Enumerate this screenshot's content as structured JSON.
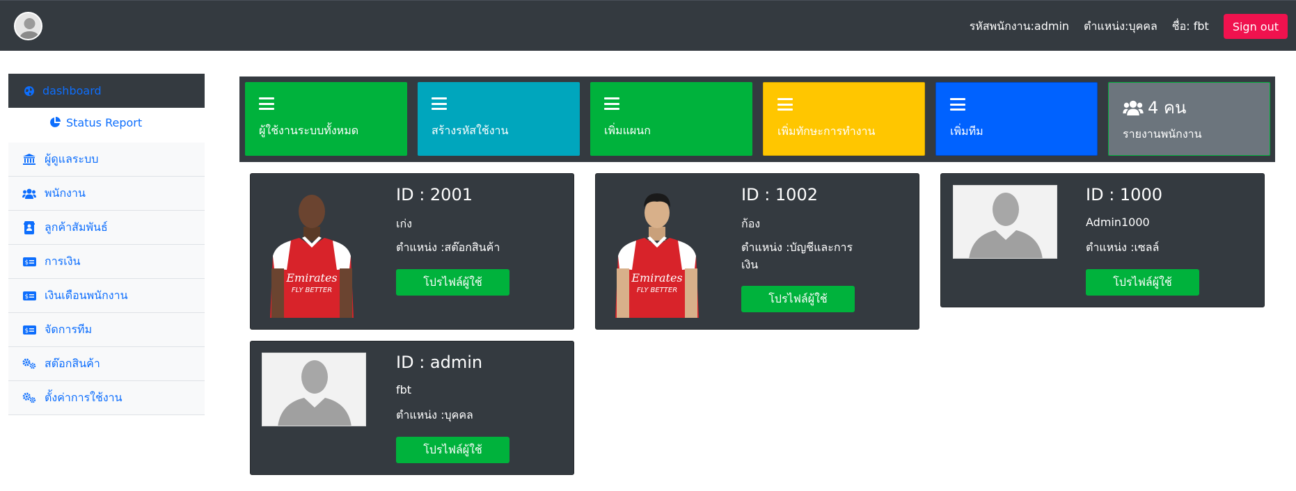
{
  "topbar": {
    "employee_id": "รหัสพนักงาน:admin",
    "position": "ตำแหน่ง:บุคคล",
    "name": "ชื่อ: fbt",
    "signout_label": "Sign out"
  },
  "sidebar": {
    "dashboard": "dashboard",
    "status_report": "Status Report",
    "items": [
      {
        "label": "ผู้ดูแลระบบ",
        "icon": "bank-icon"
      },
      {
        "label": "พนักงาน",
        "icon": "users-icon"
      },
      {
        "label": "ลูกค้าสัมพันธ์",
        "icon": "contact-book-icon"
      },
      {
        "label": "การเงิน",
        "icon": "money-card-icon"
      },
      {
        "label": "เงินเดือนพนักงาน",
        "icon": "money-card-icon"
      },
      {
        "label": "จัดการทีม",
        "icon": "money-card-icon"
      },
      {
        "label": "สต๊อกสินค้า",
        "icon": "gears-icon"
      },
      {
        "label": "ตั้งค่าการใช้งาน",
        "icon": "gears-icon"
      }
    ]
  },
  "stats": [
    {
      "label": "ผู้ใช้งานระบบทั้งหมด",
      "color": "#00b23c"
    },
    {
      "label": "สร้างรหัสใช้งาน",
      "color": "#00a6bd"
    },
    {
      "label": "เพิ่มแผนก",
      "color": "#00b23c"
    },
    {
      "label": "เพิ่มทักษะการทำงาน",
      "color": "#ffc600"
    },
    {
      "label": "เพิ่มทีม",
      "color": "#0062ff"
    },
    {
      "label": "รายงานพนักงาน",
      "count": "4 คน",
      "color": "#6c757d"
    }
  ],
  "employees": [
    {
      "id": "ID : 2001",
      "name": "เก่ง",
      "position_line1": "ตำแหน่ง :สต๊อกสินค้า",
      "position_line2": "",
      "button": "โปรไฟล์ผู้ใช้",
      "photo": "player-photo"
    },
    {
      "id": "ID : 1002",
      "name": "ก้อง",
      "position_line1": "ตำแหน่ง :บัญชีและการ",
      "position_line2": "เงิน",
      "button": "โปรไฟล์ผู้ใช้",
      "photo": "player-photo"
    },
    {
      "id": "ID : 1000",
      "name": "Admin1000",
      "position_line1": "ตำแหน่ง :เซลล์",
      "position_line2": "",
      "button": "โปรไฟล์ผู้ใช้",
      "photo": "avatar-placeholder"
    },
    {
      "id": "ID : admin",
      "name": "fbt",
      "position_line1": "ตำแหน่ง :บุคคล",
      "position_line2": "",
      "button": "โปรไฟล์ผู้ใช้",
      "photo": "avatar-placeholder"
    }
  ],
  "colors": {
    "topbar": "#343a40",
    "signout": "#f0124e",
    "link": "#0d6efd",
    "profile_button": "#00b23c",
    "jersey_red": "#d8232a"
  }
}
